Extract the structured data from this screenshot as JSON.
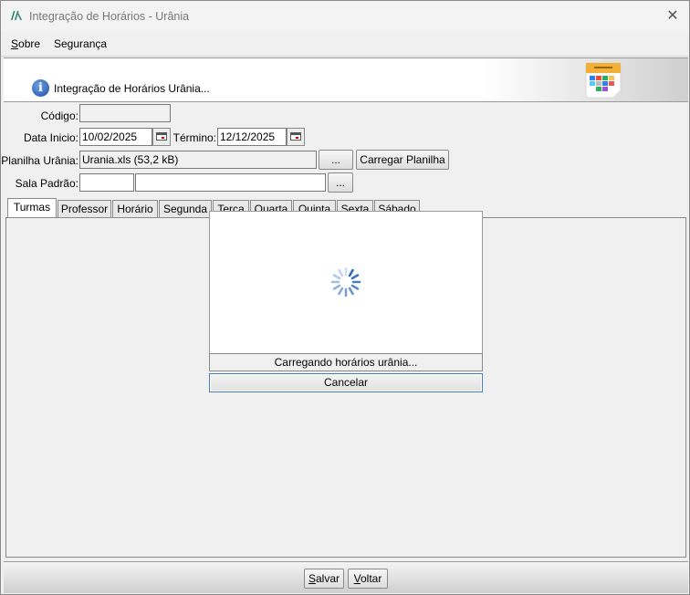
{
  "window": {
    "title": "Integração de Horários - Urânia",
    "close_glyph": "✕"
  },
  "menu": {
    "items": [
      {
        "label": "Sobre"
      },
      {
        "label": "Segurança"
      }
    ]
  },
  "header": {
    "text": "Integração de Horários Urânia..."
  },
  "form": {
    "codigo_label": "Código:",
    "codigo_value": "",
    "data_inicio_label": "Data Inicio:",
    "data_inicio_value": "10/02/2025",
    "termino_label": "Término:",
    "termino_value": "12/12/2025",
    "planilha_label": "Planilha Urânia:",
    "planilha_value": "Urania.xls (53,2 kB)",
    "browse_label": "...",
    "carregar_label": "Carregar Planilha",
    "sala_label": "Sala Padrão:",
    "sala_code_value": "",
    "sala_name_value": "",
    "sala_browse_label": "..."
  },
  "tabs": [
    {
      "label": "Turmas",
      "active": true
    },
    {
      "label": "Professor"
    },
    {
      "label": "Horário"
    },
    {
      "label": "Segunda"
    },
    {
      "label": "Terça"
    },
    {
      "label": "Quarta"
    },
    {
      "label": "Quinta"
    },
    {
      "label": "Sexta"
    },
    {
      "label": "Sábado"
    }
  ],
  "loading": {
    "status": "Carregando horários urânia...",
    "cancel_label": "Cancelar"
  },
  "footer": {
    "save_label": "Salvar",
    "back_label": "Voltar"
  },
  "colors": {
    "spinner": "#1a5fb4",
    "info_icon": "#1c4fa5",
    "focus_border": "#4a7ebb"
  }
}
